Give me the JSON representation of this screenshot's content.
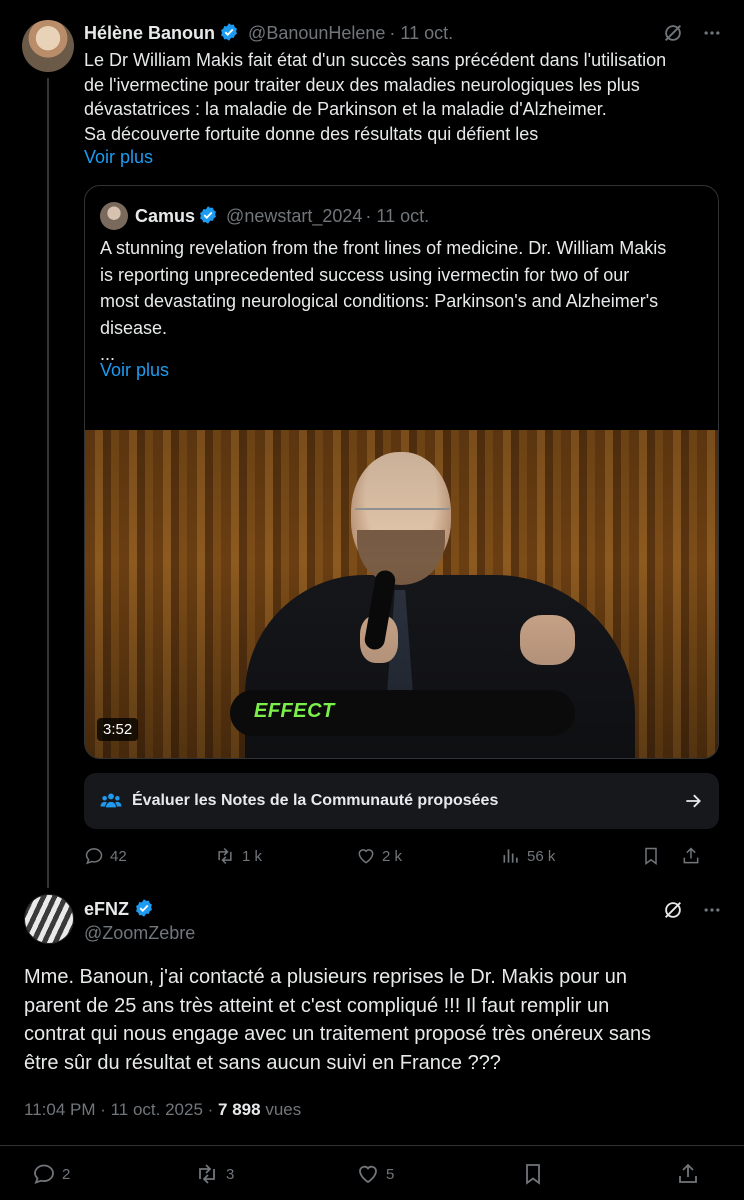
{
  "tweet": {
    "author_name": "Hélène Banoun",
    "handle": "@BanounHelene",
    "date": "· 11 oct.",
    "text_lines": [
      "Le Dr William Makis fait état d'un succès sans précédent dans l'utilisation",
      "de l'ivermectine pour traiter deux des maladies neurologiques les plus",
      "dévastatrices : la maladie de Parkinson et la maladie d'Alzheimer.",
      "Sa découverte fortuite donne des résultats qui défient les"
    ],
    "see_more": "Voir plus",
    "quote": {
      "author_name": "Camus",
      "handle": "@newstart_2024",
      "date": "· 11 oct.",
      "text_lines": [
        "A stunning revelation from the front lines of medicine. Dr. William Makis",
        "is reporting unprecedented success using ivermectin for two of our",
        "most devastating neurological conditions: Parkinson's and Alzheimer's",
        "disease.",
        "..."
      ],
      "see_more": "Voir plus",
      "video": {
        "overlay_text": "EFFECT",
        "duration": "3:52"
      }
    },
    "community_notes_label": "Évaluer les Notes de la Communauté proposées",
    "stats": {
      "replies": "42",
      "reposts": "1 k",
      "likes": "2 k",
      "views": "56 k"
    }
  },
  "reply": {
    "author_name": "eFNZ",
    "handle": "@ZoomZebre",
    "text_lines": [
      "Mme. Banoun, j'ai contacté a plusieurs reprises le Dr. Makis pour un",
      "parent de 25 ans très atteint et c'est compliqué !!! Il faut remplir un",
      "contrat qui nous engage avec un traitement proposé très onéreux sans",
      "être sûr du résultat et sans aucun suivi en France ???"
    ],
    "time": "11:04 PM · 11 oct. 2025 ·",
    "views_count": "7 898",
    "views_label": "vues",
    "stats": {
      "replies": "2",
      "reposts": "3",
      "likes": "5"
    }
  },
  "colors": {
    "background": "#000000",
    "text": "#e7e9ea",
    "muted": "#71767b",
    "link": "#1d9bf0",
    "verified": "#1d9bf0",
    "effect_text": "#7cf04a"
  }
}
